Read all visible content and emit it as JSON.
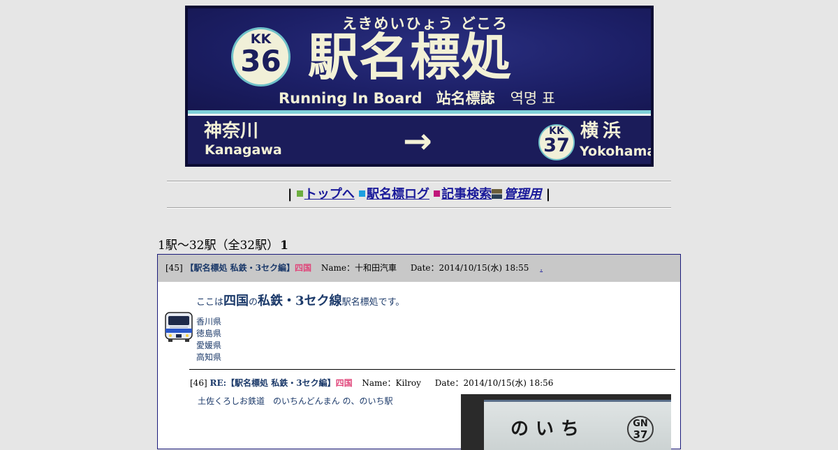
{
  "banner": {
    "furigana": "えきめいひょう どころ",
    "title": "駅名標処",
    "subtitle_en": "Running In Board",
    "subtitle_zh": "站名標誌",
    "subtitle_ko": "역명 표",
    "current_line": "KK",
    "current_number": "36",
    "prev_name": "神奈川",
    "prev_roman": "Kanagawa",
    "arrow": "→",
    "next_line": "KK",
    "next_number": "37",
    "next_name": "横浜",
    "next_roman": "Yokohama"
  },
  "nav": {
    "sep_left": "|",
    "sep_right": "|",
    "items": [
      {
        "label": "トップへ",
        "marker_color": "#6cae3f"
      },
      {
        "label": "駅名標ログ",
        "marker_color": "#1ea0e0"
      },
      {
        "label": "記事検索",
        "marker_color": "#c0167a"
      },
      {
        "label": "管理用",
        "marker_color": "#6b5e3a"
      }
    ]
  },
  "count": {
    "text": "1駅～32駅（全32駅）",
    "page": "1"
  },
  "thread": {
    "number": "[45]",
    "subject": "【駅名標処 私鉄・3セク編】",
    "region": "四国",
    "name": "Name：十和田汽車",
    "date": "Date：2014/10/15(水) 18:55",
    "link": ".",
    "intro": {
      "prefix": "ここは",
      "region": "四国",
      "mid": "の",
      "category": "私鉄・3セク線",
      "suffix": "駅名標処です。"
    },
    "prefectures": [
      "香川県",
      "徳島県",
      "愛媛県",
      "高知県"
    ],
    "reply": {
      "number": "[46]",
      "re": "RE:",
      "subject": "【駅名標処 私鉄・3セク編】",
      "region": "四国",
      "name": "Name：Kilroy",
      "date": "Date：2014/10/15(水) 18:56",
      "body": "土佐くろしお鉄道　のいちんどんまん の、のいち駅",
      "photo": {
        "sign_name": "のいち",
        "line": "GN",
        "number": "37"
      }
    }
  }
}
